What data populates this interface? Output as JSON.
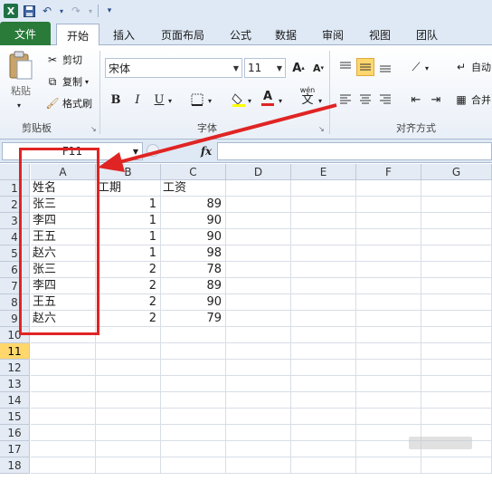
{
  "ribbon_tabs": {
    "file": "文件",
    "home": "开始",
    "insert": "插入",
    "page_layout": "页面布局",
    "formulas": "公式",
    "data": "数据",
    "review": "审阅",
    "view": "视图",
    "team": "团队"
  },
  "clipboard": {
    "paste": "粘贴",
    "cut": "剪切",
    "copy": "复制",
    "format_painter": "格式刷",
    "group_title": "剪贴板"
  },
  "font": {
    "name": "宋体",
    "size": "11",
    "bold": "B",
    "italic": "I",
    "underline": "U",
    "phonetic": "wén",
    "group_title": "字体"
  },
  "alignment": {
    "wrap_label": "自动",
    "merge_label": "合并",
    "group_title": "对齐方式"
  },
  "formula_bar": {
    "name_box": "F11",
    "fx": "fx",
    "value": ""
  },
  "sheet": {
    "columns": [
      "A",
      "B",
      "C",
      "D",
      "E",
      "F",
      "G"
    ],
    "rows": [
      "1",
      "2",
      "3",
      "4",
      "5",
      "6",
      "7",
      "8",
      "9",
      "10",
      "11",
      "12",
      "13",
      "14",
      "15",
      "16",
      "17",
      "18"
    ],
    "selected_row": "11",
    "cells": [
      [
        "姓名",
        "工期",
        "工资"
      ],
      [
        "张三",
        "1",
        "89"
      ],
      [
        "李四",
        "1",
        "90"
      ],
      [
        "王五",
        "1",
        "90"
      ],
      [
        "赵六",
        "1",
        "98"
      ],
      [
        "张三",
        "2",
        "78"
      ],
      [
        "李四",
        "2",
        "89"
      ],
      [
        "王五",
        "2",
        "90"
      ],
      [
        "赵六",
        "2",
        "79"
      ]
    ]
  },
  "annotation_color": "#e02424",
  "file_tab_color": "#2a7a3a"
}
